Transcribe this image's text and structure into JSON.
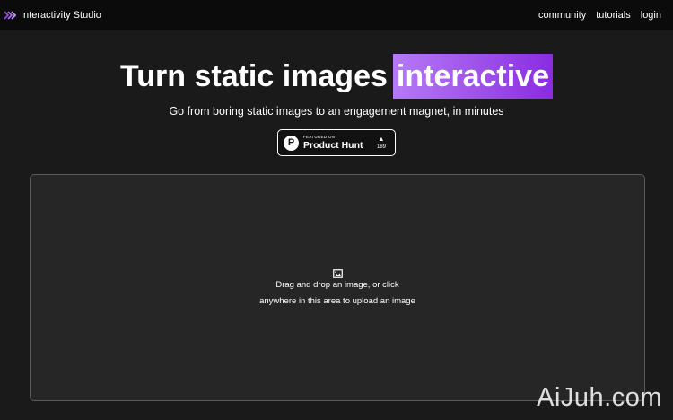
{
  "header": {
    "brand_name": "Interactivity Studio",
    "brand_icon": "double-chevron-right-icon",
    "nav": {
      "community": "community",
      "tutorials": "tutorials",
      "login": "login"
    }
  },
  "hero": {
    "title_main": "Turn static images",
    "title_highlight": "interactive",
    "subtitle": "Go from boring static images to an engagement magnet, in minutes"
  },
  "product_hunt": {
    "featured_on": "FEATURED ON",
    "name": "Product Hunt",
    "logo_letter": "P",
    "upvote_icon": "▲",
    "votes": "189"
  },
  "upload": {
    "icon": "image-icon",
    "line1": "Drag and drop an image, or click",
    "line2": "anywhere in this area to upload an image"
  },
  "watermark": "AiJuh.com",
  "colors": {
    "background": "#1a1a1a",
    "topbar": "#0b0b0b",
    "accent_gradient_start": "#b679f7",
    "accent_gradient_end": "#8a2be2",
    "dropzone_bg": "#262626",
    "dropzone_border": "#5c5c5c"
  }
}
